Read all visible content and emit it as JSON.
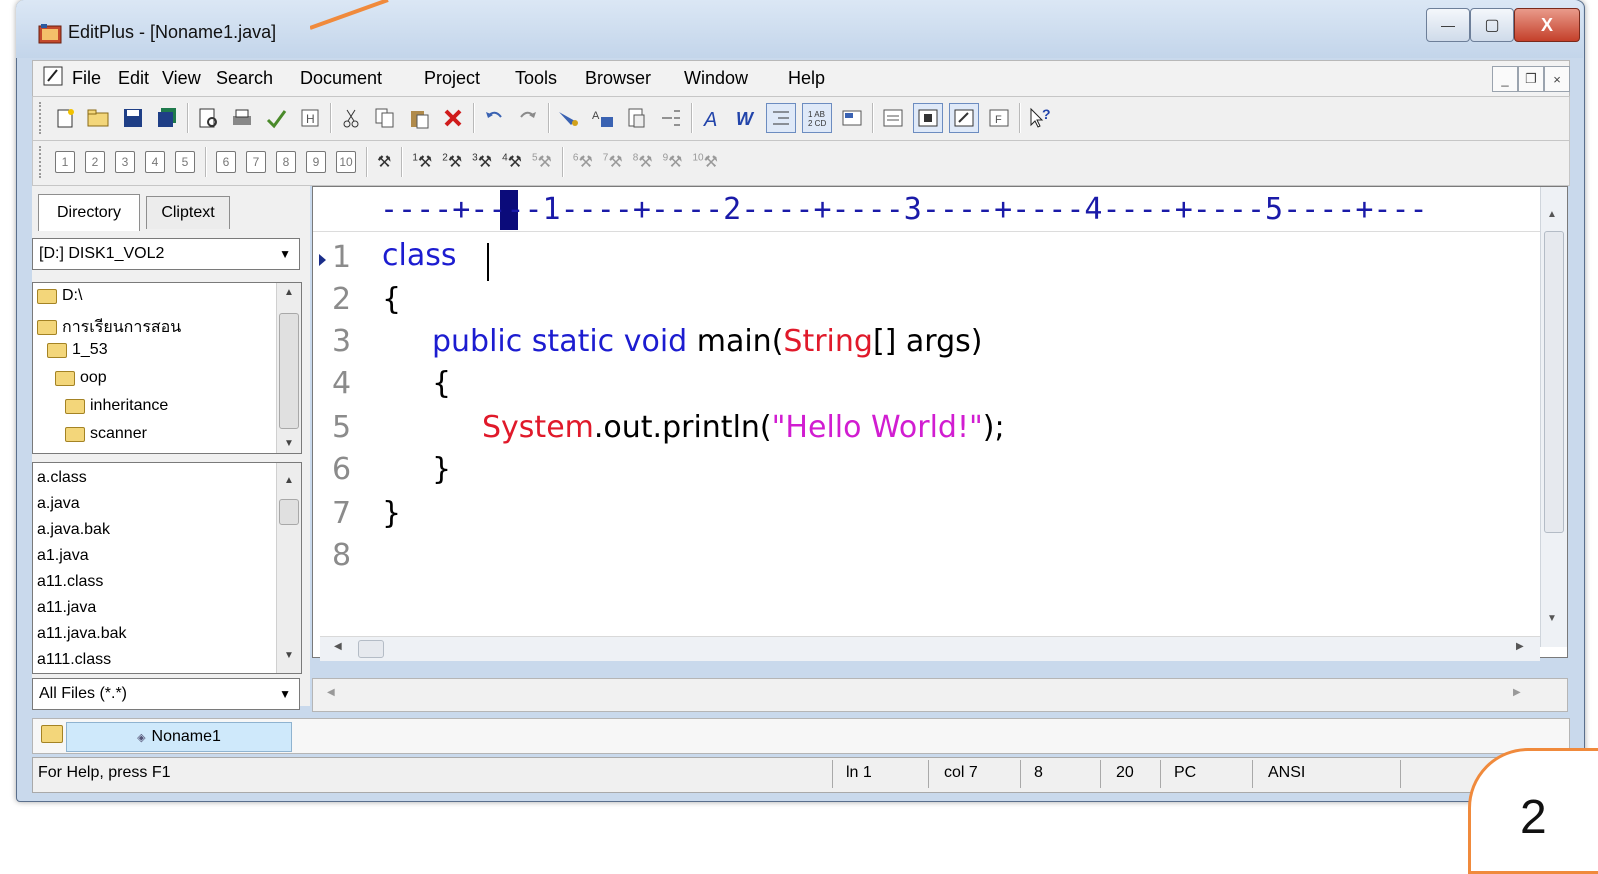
{
  "window": {
    "title": "EditPlus - [Noname1.java]",
    "min_glyph": "—",
    "max_glyph": "▢",
    "close_glyph": "X"
  },
  "menu": {
    "items": [
      "File",
      "Edit",
      "View",
      "Search",
      "Document",
      "Project",
      "Tools",
      "Browser",
      "Window",
      "Help"
    ],
    "mdi_min": "_",
    "mdi_restore": "❐",
    "mdi_close": "×"
  },
  "toolbar2": {
    "numbers": [
      "1",
      "2",
      "3",
      "4",
      "5",
      "6",
      "7",
      "8",
      "9",
      "10"
    ],
    "hammer_numbers": [
      "1",
      "2",
      "3",
      "4",
      "5",
      "6",
      "7",
      "8",
      "9",
      "10"
    ]
  },
  "sidebar": {
    "tabs": [
      "Directory",
      "Cliptext"
    ],
    "drive": "[D:] DISK1_VOL2",
    "tree": [
      "D:\\",
      "การเรียนการสอน",
      "1_53",
      "oop",
      "inheritance",
      "scanner"
    ],
    "files": [
      "a.class",
      "a.java",
      "a.java.bak",
      "a1.java",
      "a11.class",
      "a11.java",
      "a11.java.bak",
      "a111.class"
    ],
    "filter": "All Files (*.*)"
  },
  "editor": {
    "ruler": "----+----1----+----2----+----3----+----4----+----5----+---",
    "line_numbers": [
      "1",
      "2",
      "3",
      "4",
      "5",
      "6",
      "7",
      "8"
    ],
    "lines": [
      {
        "text": "class"
      },
      {
        "text": "{"
      },
      {
        "kw": "public static void",
        "plain1": " main(",
        "cls": "String",
        "plain2": "[] args)"
      },
      {
        "text": "{"
      },
      {
        "cls": "System",
        "plain1": ".out.println(",
        "str": "\"Hello World!\"",
        "plain2": ");"
      },
      {
        "text": "}"
      },
      {
        "text": "}"
      }
    ]
  },
  "doc_tab": {
    "label": "Noname1"
  },
  "status": {
    "help": "For Help, press F1",
    "ln": "ln 1",
    "col": "col 7",
    "count1": "8",
    "count2": "20",
    "eol": "PC",
    "encoding": "ANSI"
  },
  "slide": {
    "number": "2"
  },
  "colors": {
    "keyword": "#1c1cd0",
    "class": "#e0192a",
    "string": "#d11dd1",
    "ruler": "#1a1aa8"
  }
}
